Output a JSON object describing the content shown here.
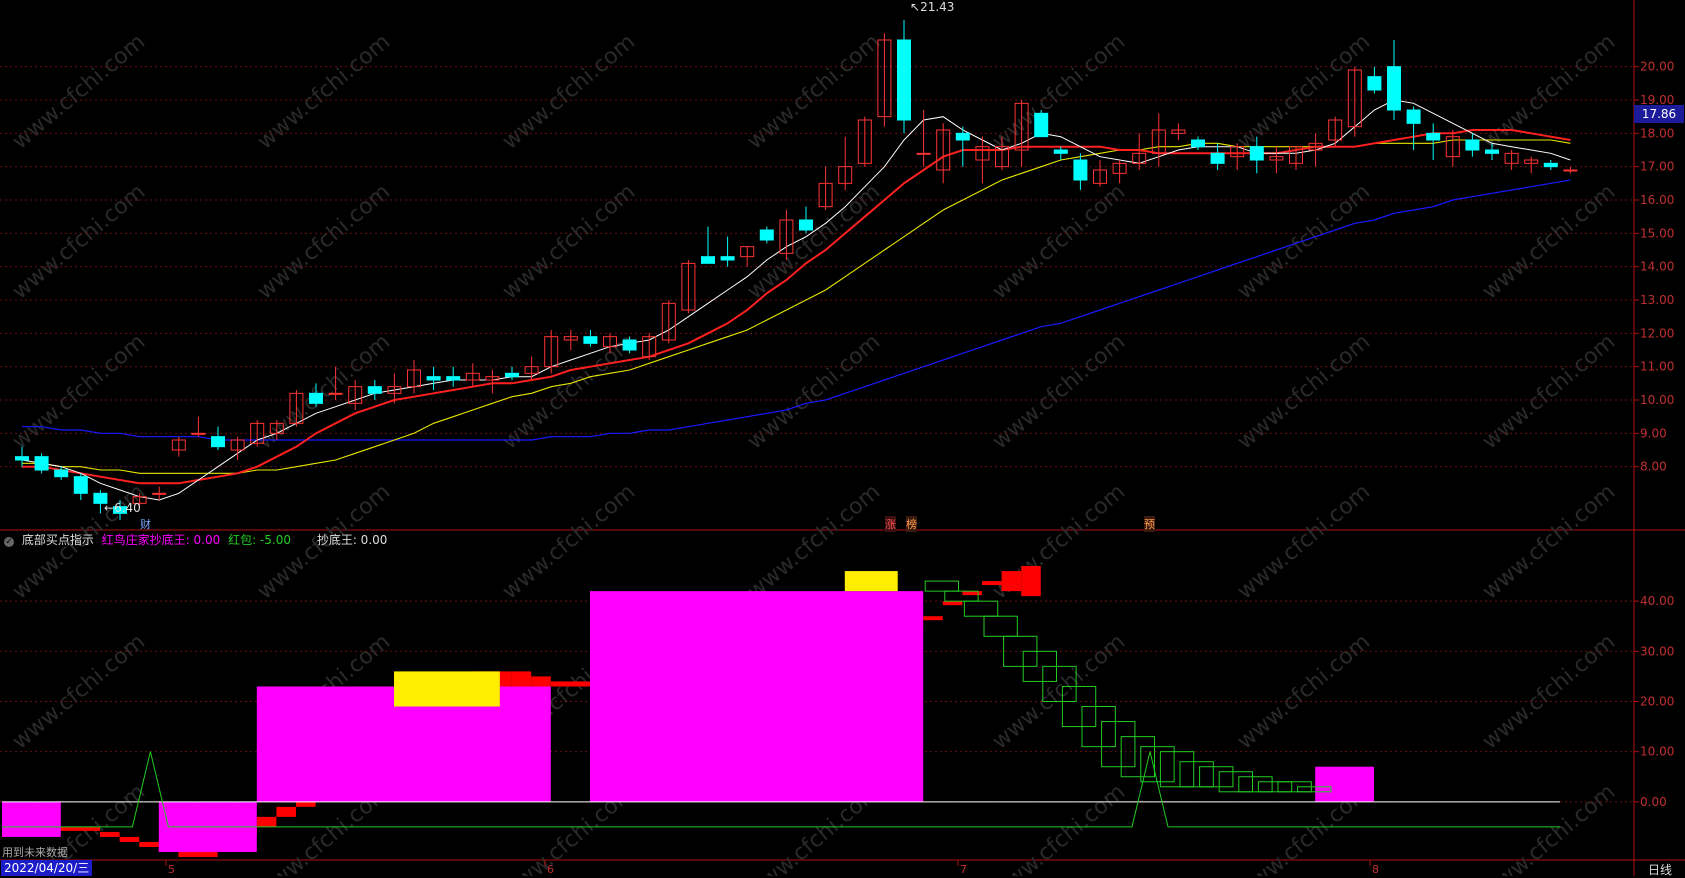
{
  "price_tag": "17.86",
  "price_axis": [
    "20.00",
    "19.00",
    "18.00",
    "17.00",
    "16.00",
    "15.00",
    "14.00",
    "13.00",
    "12.00",
    "11.00",
    "10.00",
    "9.00",
    "8.00"
  ],
  "indicator_axis": [
    "40.00",
    "30.00",
    "20.00",
    "10.00",
    "0.00"
  ],
  "indicator": {
    "name": "底部买点指示",
    "items": [
      {
        "label": "红鸟庄家抄底王: 0.00",
        "color": "#ff00ff"
      },
      {
        "label": "红包: -5.00",
        "color": "#22cc22"
      },
      {
        "label": "抄底王: 0.00",
        "color": "#dddddd"
      }
    ]
  },
  "annotations": {
    "high": "21.43",
    "low": "6.40",
    "low_marker": "财"
  },
  "events": [
    "涨",
    "榜",
    "预"
  ],
  "month_ticks": [
    "5",
    "6",
    "7",
    "8"
  ],
  "footer": {
    "date": "2022/04/20/三",
    "period": "日线",
    "future_note": "用到未来数据"
  },
  "watermark": "www.cfchi.com",
  "colors": {
    "up": "#ff3333",
    "down": "#00ffff",
    "ma5": "#ffffff",
    "ma10": "#ff2020",
    "ma20": "#e6e600",
    "ma_long": "#1a1aff",
    "magenta": "#ff00ff",
    "yellow": "#ffee00",
    "green": "#22cc22"
  },
  "chart_data": [
    {
      "type": "candlestick",
      "title": "",
      "ylim": [
        6.1,
        22.0
      ],
      "ohlc": [
        [
          8.3,
          8.6,
          8.0,
          8.2
        ],
        [
          8.3,
          8.4,
          7.8,
          7.9
        ],
        [
          7.9,
          8.0,
          7.6,
          7.7
        ],
        [
          7.7,
          7.8,
          7.0,
          7.2
        ],
        [
          7.2,
          7.3,
          6.6,
          6.9
        ],
        [
          6.8,
          7.0,
          6.4,
          6.6
        ],
        [
          6.9,
          7.2,
          6.8,
          7.1
        ],
        [
          7.2,
          7.4,
          7.0,
          7.2
        ],
        [
          8.5,
          8.9,
          8.3,
          8.8
        ],
        [
          9.0,
          9.5,
          8.9,
          9.0
        ],
        [
          8.9,
          9.2,
          8.5,
          8.6
        ],
        [
          8.5,
          8.9,
          8.2,
          8.8
        ],
        [
          8.7,
          9.4,
          8.6,
          9.3
        ],
        [
          9.0,
          9.4,
          8.8,
          9.3
        ],
        [
          9.3,
          10.3,
          9.2,
          10.2
        ],
        [
          10.2,
          10.5,
          9.8,
          9.9
        ],
        [
          10.2,
          11.0,
          10.0,
          10.2
        ],
        [
          9.9,
          10.6,
          9.7,
          10.4
        ],
        [
          10.4,
          10.6,
          10.0,
          10.2
        ],
        [
          10.2,
          10.8,
          9.9,
          10.4
        ],
        [
          10.4,
          11.2,
          10.2,
          10.9
        ],
        [
          10.7,
          11.0,
          10.3,
          10.6
        ],
        [
          10.7,
          11.0,
          10.4,
          10.6
        ],
        [
          10.6,
          11.1,
          10.4,
          10.8
        ],
        [
          10.6,
          10.9,
          10.2,
          10.7
        ],
        [
          10.8,
          11.0,
          10.6,
          10.7
        ],
        [
          10.8,
          11.3,
          10.6,
          11.0
        ],
        [
          11.0,
          12.1,
          10.8,
          11.9
        ],
        [
          11.8,
          12.1,
          11.5,
          11.9
        ],
        [
          11.9,
          12.1,
          11.6,
          11.7
        ],
        [
          11.6,
          12.0,
          11.4,
          11.9
        ],
        [
          11.8,
          11.9,
          11.4,
          11.5
        ],
        [
          11.3,
          12.0,
          11.2,
          11.9
        ],
        [
          11.8,
          13.0,
          11.7,
          12.9
        ],
        [
          12.7,
          14.2,
          12.6,
          14.1
        ],
        [
          14.3,
          15.2,
          14.1,
          14.1
        ],
        [
          14.3,
          14.9,
          14.0,
          14.2
        ],
        [
          14.3,
          14.6,
          14.0,
          14.6
        ],
        [
          15.1,
          15.2,
          14.7,
          14.8
        ],
        [
          14.4,
          15.7,
          14.2,
          15.4
        ],
        [
          15.4,
          15.8,
          15.0,
          15.1
        ],
        [
          15.8,
          17.0,
          15.7,
          16.5
        ],
        [
          16.5,
          17.9,
          16.3,
          17.0
        ],
        [
          17.1,
          18.5,
          17.0,
          18.4
        ],
        [
          18.5,
          21.0,
          18.2,
          20.8
        ],
        [
          20.8,
          21.4,
          18.0,
          18.4
        ],
        [
          17.4,
          18.7,
          17.0,
          17.4
        ],
        [
          16.9,
          18.3,
          16.5,
          18.1
        ],
        [
          18.0,
          18.2,
          17.0,
          17.8
        ],
        [
          17.2,
          17.9,
          16.5,
          17.6
        ],
        [
          17.0,
          17.9,
          16.9,
          17.6
        ],
        [
          17.5,
          19.0,
          17.0,
          18.9
        ],
        [
          18.6,
          18.7,
          17.9,
          17.9
        ],
        [
          17.5,
          17.6,
          17.2,
          17.4
        ],
        [
          17.2,
          17.4,
          16.3,
          16.6
        ],
        [
          16.5,
          17.2,
          16.4,
          16.9
        ],
        [
          16.8,
          17.2,
          16.5,
          17.1
        ],
        [
          17.1,
          18.0,
          16.9,
          17.4
        ],
        [
          17.4,
          18.6,
          17.0,
          18.1
        ],
        [
          18.0,
          18.3,
          17.8,
          18.1
        ],
        [
          17.8,
          17.9,
          17.5,
          17.6
        ],
        [
          17.4,
          17.7,
          16.9,
          17.1
        ],
        [
          17.3,
          17.7,
          16.9,
          17.6
        ],
        [
          17.6,
          17.9,
          16.8,
          17.2
        ],
        [
          17.2,
          17.6,
          16.8,
          17.3
        ],
        [
          17.1,
          17.6,
          16.9,
          17.6
        ],
        [
          17.5,
          18.0,
          17.0,
          17.7
        ],
        [
          17.8,
          18.5,
          17.6,
          18.4
        ],
        [
          18.2,
          20.0,
          17.9,
          19.9
        ],
        [
          19.7,
          20.0,
          19.2,
          19.3
        ],
        [
          20.0,
          20.8,
          18.4,
          18.7
        ],
        [
          18.7,
          18.8,
          17.5,
          18.3
        ],
        [
          18.0,
          18.3,
          17.2,
          17.8
        ],
        [
          17.3,
          18.1,
          17.0,
          17.9
        ],
        [
          17.8,
          18.0,
          17.3,
          17.5
        ],
        [
          17.5,
          17.7,
          17.2,
          17.4
        ],
        [
          17.1,
          17.5,
          16.9,
          17.4
        ],
        [
          17.1,
          17.3,
          16.8,
          17.2
        ],
        [
          17.1,
          17.2,
          16.9,
          17.0
        ],
        [
          16.9,
          17.0,
          16.8,
          16.9
        ]
      ],
      "ma5": [
        8.2,
        8.1,
        8.0,
        7.8,
        7.5,
        7.3,
        7.1,
        7.0,
        7.2,
        7.6,
        8.0,
        8.4,
        8.8,
        9.0,
        9.3,
        9.6,
        9.8,
        10.0,
        10.2,
        10.3,
        10.4,
        10.5,
        10.6,
        10.6,
        10.6,
        10.7,
        10.7,
        11.0,
        11.2,
        11.4,
        11.6,
        11.7,
        11.8,
        12.1,
        12.5,
        12.9,
        13.3,
        13.7,
        14.2,
        14.6,
        14.9,
        15.3,
        15.8,
        16.4,
        17.0,
        17.8,
        18.4,
        18.5,
        18.1,
        17.8,
        17.5,
        17.7,
        18.0,
        17.9,
        17.6,
        17.3,
        17.2,
        17.1,
        17.3,
        17.5,
        17.6,
        17.6,
        17.6,
        17.4,
        17.4,
        17.4,
        17.5,
        17.7,
        18.2,
        18.7,
        19.0,
        18.9,
        18.6,
        18.3,
        18.0,
        17.7,
        17.6,
        17.5,
        17.4,
        17.2
      ],
      "ma10": [
        8.0,
        8.0,
        7.9,
        7.8,
        7.7,
        7.6,
        7.5,
        7.5,
        7.5,
        7.6,
        7.7,
        7.8,
        8.0,
        8.3,
        8.6,
        9.0,
        9.3,
        9.6,
        9.8,
        10.0,
        10.1,
        10.2,
        10.3,
        10.4,
        10.5,
        10.5,
        10.6,
        10.7,
        10.9,
        11.0,
        11.1,
        11.2,
        11.3,
        11.5,
        11.7,
        12.0,
        12.3,
        12.7,
        13.2,
        13.6,
        14.1,
        14.5,
        15.0,
        15.5,
        16.0,
        16.5,
        16.9,
        17.3,
        17.5,
        17.5,
        17.5,
        17.6,
        17.6,
        17.6,
        17.6,
        17.6,
        17.5,
        17.5,
        17.4,
        17.4,
        17.4,
        17.4,
        17.4,
        17.4,
        17.4,
        17.5,
        17.6,
        17.6,
        17.6,
        17.7,
        17.8,
        17.9,
        18.0,
        18.0,
        18.1,
        18.1,
        18.1,
        18.0,
        17.9,
        17.8
      ],
      "ma20": [
        8.1,
        8.1,
        8.0,
        8.0,
        7.9,
        7.9,
        7.8,
        7.8,
        7.8,
        7.8,
        7.8,
        7.8,
        7.9,
        7.9,
        8.0,
        8.1,
        8.2,
        8.4,
        8.6,
        8.8,
        9.0,
        9.3,
        9.5,
        9.7,
        9.9,
        10.1,
        10.2,
        10.4,
        10.5,
        10.7,
        10.8,
        10.9,
        11.1,
        11.3,
        11.5,
        11.7,
        11.9,
        12.1,
        12.4,
        12.7,
        13.0,
        13.3,
        13.7,
        14.1,
        14.5,
        14.9,
        15.3,
        15.7,
        16.0,
        16.3,
        16.6,
        16.8,
        17.0,
        17.2,
        17.3,
        17.4,
        17.5,
        17.5,
        17.6,
        17.6,
        17.7,
        17.7,
        17.6,
        17.6,
        17.6,
        17.6,
        17.6,
        17.6,
        17.6,
        17.7,
        17.7,
        17.7,
        17.7,
        17.8,
        17.8,
        17.8,
        17.8,
        17.8,
        17.8,
        17.7
      ],
      "ma_long": [
        9.2,
        9.2,
        9.1,
        9.1,
        9.0,
        9.0,
        8.9,
        8.9,
        8.9,
        8.9,
        8.8,
        8.8,
        8.8,
        8.8,
        8.8,
        8.8,
        8.8,
        8.8,
        8.8,
        8.8,
        8.8,
        8.8,
        8.8,
        8.8,
        8.8,
        8.8,
        8.8,
        8.9,
        8.9,
        8.9,
        9.0,
        9.0,
        9.1,
        9.1,
        9.2,
        9.3,
        9.4,
        9.5,
        9.6,
        9.7,
        9.9,
        10.0,
        10.2,
        10.4,
        10.6,
        10.8,
        11.0,
        11.2,
        11.4,
        11.6,
        11.8,
        12.0,
        12.2,
        12.3,
        12.5,
        12.7,
        12.9,
        13.1,
        13.3,
        13.5,
        13.7,
        13.9,
        14.1,
        14.3,
        14.5,
        14.7,
        14.9,
        15.1,
        15.3,
        15.4,
        15.6,
        15.7,
        15.8,
        16.0,
        16.1,
        16.2,
        16.3,
        16.4,
        16.5,
        16.6
      ]
    },
    {
      "type": "bar",
      "title": "底部买点指示",
      "ylim": [
        -10,
        50
      ],
      "red_tops": [
        -5,
        -5,
        -6,
        -7,
        -8,
        -9,
        -10,
        -10,
        -7,
        -5,
        -3,
        -1,
        1,
        2,
        4,
        6,
        8,
        10,
        14,
        19,
        25,
        26,
        26,
        26,
        25,
        24,
        24,
        23,
        23,
        22,
        21,
        21,
        22,
        23,
        24,
        25,
        26,
        27,
        28,
        29,
        30,
        31,
        33,
        35,
        37,
        40,
        42,
        44,
        46,
        47
      ],
      "red_bottoms": [
        -5,
        -5,
        -7,
        -8,
        -9,
        -10,
        -11,
        -11,
        -9,
        -7,
        -5,
        -3,
        -1,
        1,
        2,
        4,
        6,
        8,
        10,
        14,
        19,
        23,
        23,
        23,
        23,
        23,
        23,
        22,
        21,
        20,
        21,
        21,
        22,
        23,
        24,
        25,
        26,
        27,
        28,
        29,
        30,
        31,
        33,
        35,
        37,
        40,
        42,
        44,
        42,
        41
      ],
      "magenta_tops": [
        0,
        0,
        0,
        0,
        0,
        0,
        0,
        0,
        0,
        0,
        0,
        0,
        0,
        0,
        0,
        0,
        0,
        0,
        0,
        0,
        0,
        0,
        0,
        0,
        0,
        0,
        0,
        0,
        0,
        0,
        0,
        0,
        0,
        0,
        0,
        0,
        0,
        0,
        0,
        0,
        0,
        0,
        0,
        0,
        0,
        0,
        0,
        0,
        0,
        0
      ],
      "magenta_segments": [
        [
          0,
          2,
          -7,
          0
        ],
        [
          8,
          12,
          -10,
          0
        ],
        [
          13,
          27,
          0,
          23
        ],
        [
          30,
          46,
          0,
          42
        ],
        [
          67,
          69,
          0,
          7
        ]
      ],
      "yellow_segments": [
        [
          20,
          26,
          19,
          26
        ],
        [
          43,
          46,
          42,
          46
        ]
      ],
      "green_boxes": [
        [
          47,
          44,
          42
        ],
        [
          48,
          42,
          40
        ],
        [
          49,
          40,
          37
        ],
        [
          50,
          37,
          33
        ],
        [
          51,
          33,
          27
        ],
        [
          52,
          30,
          24
        ],
        [
          53,
          27,
          20
        ],
        [
          54,
          23,
          15
        ],
        [
          55,
          19,
          11
        ],
        [
          56,
          16,
          7
        ],
        [
          57,
          13,
          5
        ],
        [
          58,
          11,
          4
        ],
        [
          59,
          10,
          3
        ],
        [
          60,
          8,
          3
        ],
        [
          61,
          7,
          3
        ],
        [
          62,
          6,
          2
        ],
        [
          63,
          5,
          2
        ],
        [
          64,
          4,
          2
        ],
        [
          65,
          4,
          2
        ],
        [
          66,
          3,
          2
        ]
      ],
      "spikes": [
        4,
        55
      ],
      "flat_level": -5
    }
  ]
}
